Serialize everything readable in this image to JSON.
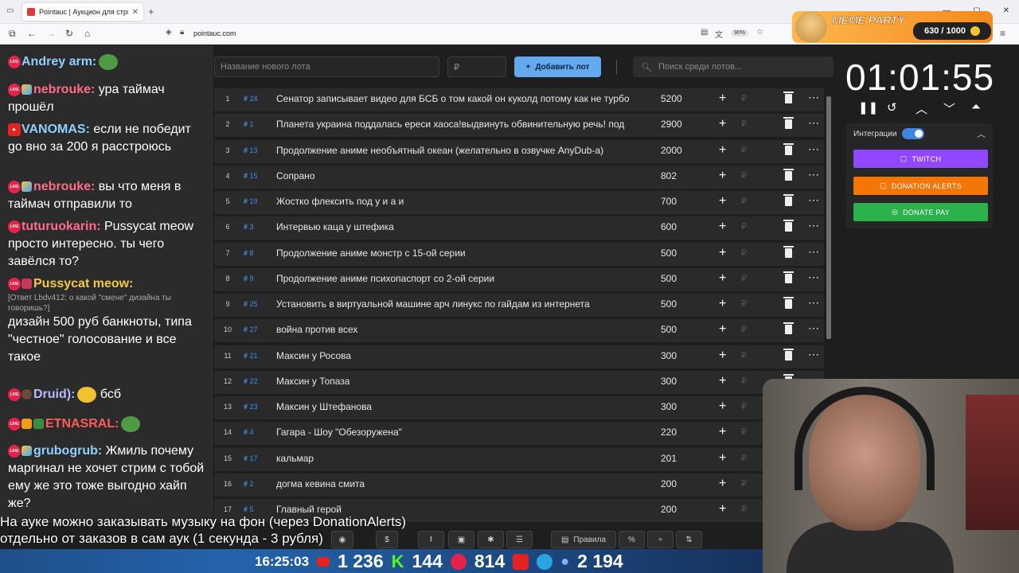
{
  "browser": {
    "tab_title": "Pointauc | Аукцион для стримеров",
    "url": "pointauc.com",
    "zoom": "90%"
  },
  "meme_party": {
    "title": "MEME PARTY",
    "score": "630 / 1000"
  },
  "chat": [
    {
      "nick": "Andrey arm:",
      "nick_color": "#8fd0ff",
      "text": ""
    },
    {
      "nick": "nebrouke:",
      "nick_color": "#ff6d8c",
      "text": "ура таймач прошёл"
    },
    {
      "nick": "VANOMAS:",
      "nick_color": "#8fd0ff",
      "text": "если не победит go вно за 200 я расстроюсь"
    },
    {
      "nick": "nebrouke:",
      "nick_color": "#ff6d8c",
      "text": "вы что меня в таймач отправили то"
    },
    {
      "nick": "tuturuokarin:",
      "nick_color": "#ff6d8c",
      "text": "Pussycat meow просто интересно. ты чего завёлся то?"
    },
    {
      "nick": "Pussycat meow:",
      "nick_color": "#f2c84b",
      "reply": "[Ответ Lbdv412: о какой \"смене\" дизайна ты говоришь?]",
      "text": "дизайн 500 руб банкноты, типа \"честное\" голосование и все такое"
    },
    {
      "nick": "Druid):",
      "nick_color": "#b9b9ff",
      "text": "бсб"
    },
    {
      "nick": "ЕТNАSRАL:",
      "nick_color": "#ff5b5b",
      "text": ""
    },
    {
      "nick": "grubogrub:",
      "nick_color": "#8fd0ff",
      "text": "Жмиль почему маргинал не хочет стрим с тобой ему же это тоже выгодно хайп же?"
    }
  ],
  "toolbar": {
    "lot_placeholder": "Название нового лота",
    "rub_placeholder": "₽",
    "add_label": "Добавить лот",
    "search_placeholder": "Поиск среди лотов..."
  },
  "lots": [
    {
      "rank": "1",
      "id": "24",
      "name": "Сенатор записывает видео для БСБ о том какой он куколд потому как не турбо",
      "amount": "5200"
    },
    {
      "rank": "2",
      "id": "1",
      "name": "Планета украина поддалась ереси хаоса!выдвинуть обвинительную речь! под",
      "amount": "2900"
    },
    {
      "rank": "3",
      "id": "13",
      "name": "Продолжение аниме необъятный океан (желательно в озвучке AnyDub-а)",
      "amount": "2000"
    },
    {
      "rank": "4",
      "id": "15",
      "name": "Сопрано",
      "amount": "802"
    },
    {
      "rank": "5",
      "id": "19",
      "name": "Жостко флексить под у и а и",
      "amount": "700"
    },
    {
      "rank": "6",
      "id": "3",
      "name": "Интервью каца у штефика",
      "amount": "600"
    },
    {
      "rank": "7",
      "id": "8",
      "name": "Продолжение аниме монстр с 15-ой серии",
      "amount": "500"
    },
    {
      "rank": "8",
      "id": "9",
      "name": "Продолжение аниме психопаспорт со 2-ой серии",
      "amount": "500"
    },
    {
      "rank": "9",
      "id": "25",
      "name": "Установить в виртуальной машине арч линукс по гайдам из интернета",
      "amount": "500"
    },
    {
      "rank": "10",
      "id": "27",
      "name": "война против всех",
      "amount": "500"
    },
    {
      "rank": "11",
      "id": "21",
      "name": "Максин у Росова",
      "amount": "300"
    },
    {
      "rank": "12",
      "id": "22",
      "name": "Максин у Топаза",
      "amount": "300"
    },
    {
      "rank": "13",
      "id": "23",
      "name": "Максин у Штефанова",
      "amount": "300"
    },
    {
      "rank": "14",
      "id": "4",
      "name": "Гагара - Шоу \"Обезоружена\"",
      "amount": "220"
    },
    {
      "rank": "15",
      "id": "17",
      "name": "кальмар",
      "amount": "201"
    },
    {
      "rank": "16",
      "id": "2",
      "name": "догма кевина смита",
      "amount": "200"
    },
    {
      "rank": "17",
      "id": "5",
      "name": "Главный герой",
      "amount": "200"
    }
  ],
  "bottom": {
    "rules_label": "Правила",
    "percent_label": "%"
  },
  "timer": "01:01:55",
  "integrations": {
    "title": "Интеграции",
    "twitch": "TWITCH",
    "donation_alerts": "DONATION ALERTS",
    "donate_pay": "DONATE PAY"
  },
  "overlay": {
    "ticker_line1": "На ауке можно заказывать музыку на фон (через DonationAlerts)",
    "ticker_line2": "отдельно от заказов в сам аук (1 секунда - 3 рубля)",
    "clock": "16:25:03",
    "youtube": "1 236",
    "kick": "144",
    "live": "814",
    "viewers": "2 194"
  },
  "colors": {
    "accent": "#64a9f0",
    "twitch": "#9146ff",
    "donation_alerts": "#f57507",
    "donate_pay": "#2bb24c"
  }
}
